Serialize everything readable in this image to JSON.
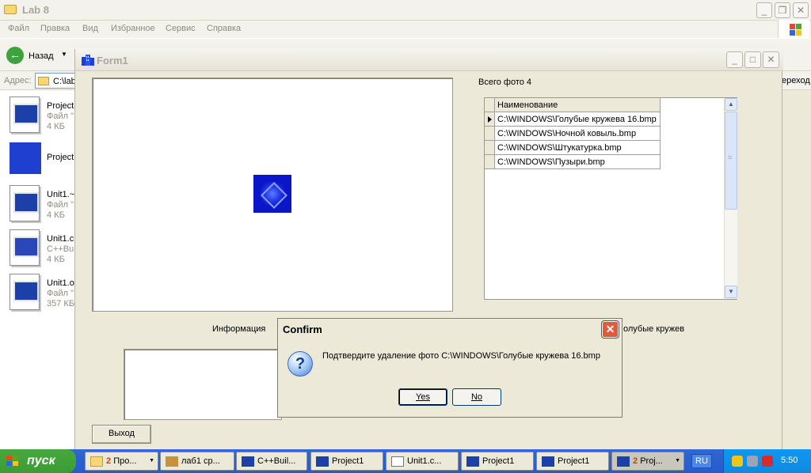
{
  "explorer": {
    "title": "Lab 8",
    "menu": [
      "Файл",
      "Правка",
      "Вид",
      "Избранное",
      "Сервис",
      "Справка"
    ],
    "back_label": "Назад",
    "address_label": "Адрес:",
    "address_value": "C:\\lab",
    "goto_label": "ереход",
    "files": [
      {
        "name": "Project",
        "type": "Файл \"",
        "size": "4 КБ"
      },
      {
        "name": "Project",
        "type": "",
        "size": ""
      },
      {
        "name": "Unit1.~",
        "type": "Файл \"",
        "size": "4 КБ"
      },
      {
        "name": "Unit1.cp",
        "type": "C++Bui",
        "size": "4 КБ"
      },
      {
        "name": "Unit1.o",
        "type": "Файл \"",
        "size": "357 КБ"
      }
    ]
  },
  "form1": {
    "title": "Form1",
    "total_label": "Всего фото 4",
    "grid": {
      "header": "Наименование",
      "rows": [
        "C:\\WINDOWS\\Голубые кружева 16.bmp",
        "C:\\WINDOWS\\Ночной ковыль.bmp",
        "C:\\WINDOWS\\Штукатурка.bmp",
        "C:\\WINDOWS\\Пузыри.bmp"
      ]
    },
    "info_label": "Информация",
    "info_tail": "олубые кружев",
    "exit_label": "Выход"
  },
  "confirm": {
    "title": "Confirm",
    "message": "Подтвердите удаление фото C:\\WINDOWS\\Голубые кружева 16.bmp",
    "yes_label": "Yes",
    "no_label": "No",
    "icon": "question-icon"
  },
  "taskbar": {
    "start_label": "пуск",
    "buttons": [
      {
        "count": "2",
        "label": "Про..."
      },
      {
        "count": "",
        "label": "лаб1 ср..."
      },
      {
        "count": "",
        "label": "C++Buil..."
      },
      {
        "count": "",
        "label": "Project1"
      },
      {
        "count": "",
        "label": "Unit1.c..."
      },
      {
        "count": "",
        "label": "Project1"
      },
      {
        "count": "",
        "label": "Project1"
      },
      {
        "count": "2",
        "label": "Proj..."
      }
    ],
    "lang": "RU",
    "clock": "5:50"
  },
  "colors": {
    "accent_blue": "#245bd0",
    "start_green": "#3a9d33",
    "close_red": "#e05a3c"
  }
}
